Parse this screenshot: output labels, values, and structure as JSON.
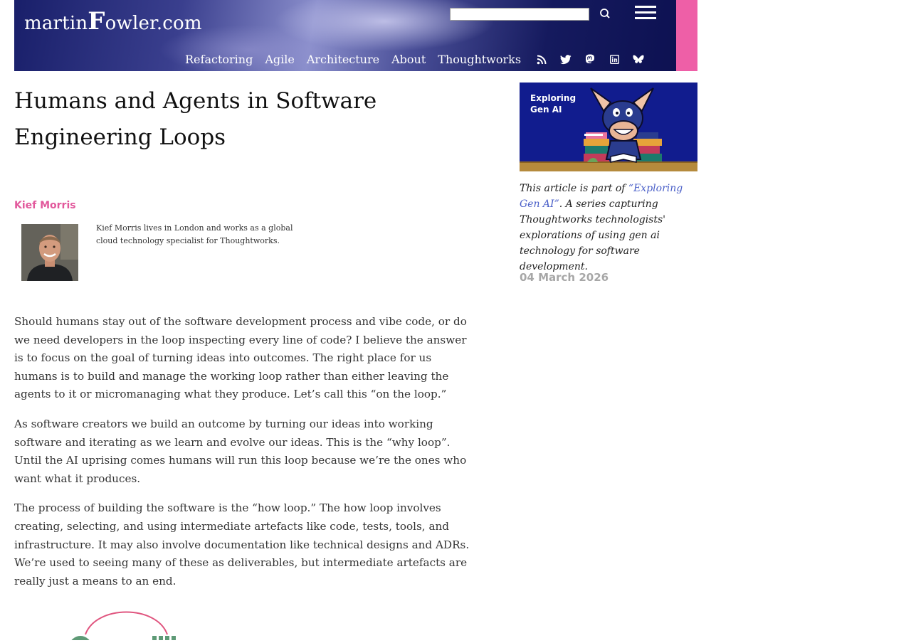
{
  "header": {
    "logo": {
      "prefix": "martin",
      "big_letter": "F",
      "suffix": "owler.com"
    },
    "search": {
      "value": "",
      "placeholder": ""
    },
    "nav": [
      "Refactoring",
      "Agile",
      "Architecture",
      "About",
      "Thoughtworks"
    ],
    "social_icons": [
      "rss-icon",
      "twitter-icon",
      "mastodon-icon",
      "linkedin-icon",
      "bluesky-icon"
    ],
    "colors": {
      "banner": "#151a5e",
      "accent_tab": "#ee5fa7"
    }
  },
  "article": {
    "title": "Humans and Agents in Software Engineering Loops",
    "author": {
      "name": "Kief Morris",
      "bio": "Kief Morris lives in London and works as a global cloud technology specialist for Thoughtworks."
    },
    "paragraphs": [
      "Should humans stay out of the software development process and vibe code, or do we need developers in the loop inspecting every line of code? I believe the answer is to focus on the goal of turning ideas into outcomes. The right place for us humans is to build and manage the working loop rather than either leaving the agents to it or micromanaging what they produce. Let’s call this “on the loop.”",
      "As software creators we build an outcome by turning our ideas into working software and iterating as we learn and evolve our ideas. This is the “why loop”. Until the AI uprising comes humans will run this loop because we’re the ones who want what it produces.",
      "The process of building the software is the “how loop.” The how loop involves creating, selecting, and using intermediate artefacts like code, tests, tools, and infrastructure. It may also involve documentation like technical designs and ADRs. We’re used to seeing many of these as deliverables, but intermediate artefacts are really just a means to an end."
    ]
  },
  "sidebar": {
    "banner_label_line1": "Exploring",
    "banner_label_line2": "Gen AI",
    "series_intro": "This article is part of ",
    "series_link": "“Exploring Gen AI”",
    "series_rest": ". A series capturing Thoughtworks technologists' explorations of using gen ai technology for software development.",
    "date": "04 March 2026",
    "colors": {
      "banner_bg": "#111c8e",
      "author": "#e2589c",
      "link": "#4a5fc8",
      "date": "#a7a7a7"
    }
  }
}
